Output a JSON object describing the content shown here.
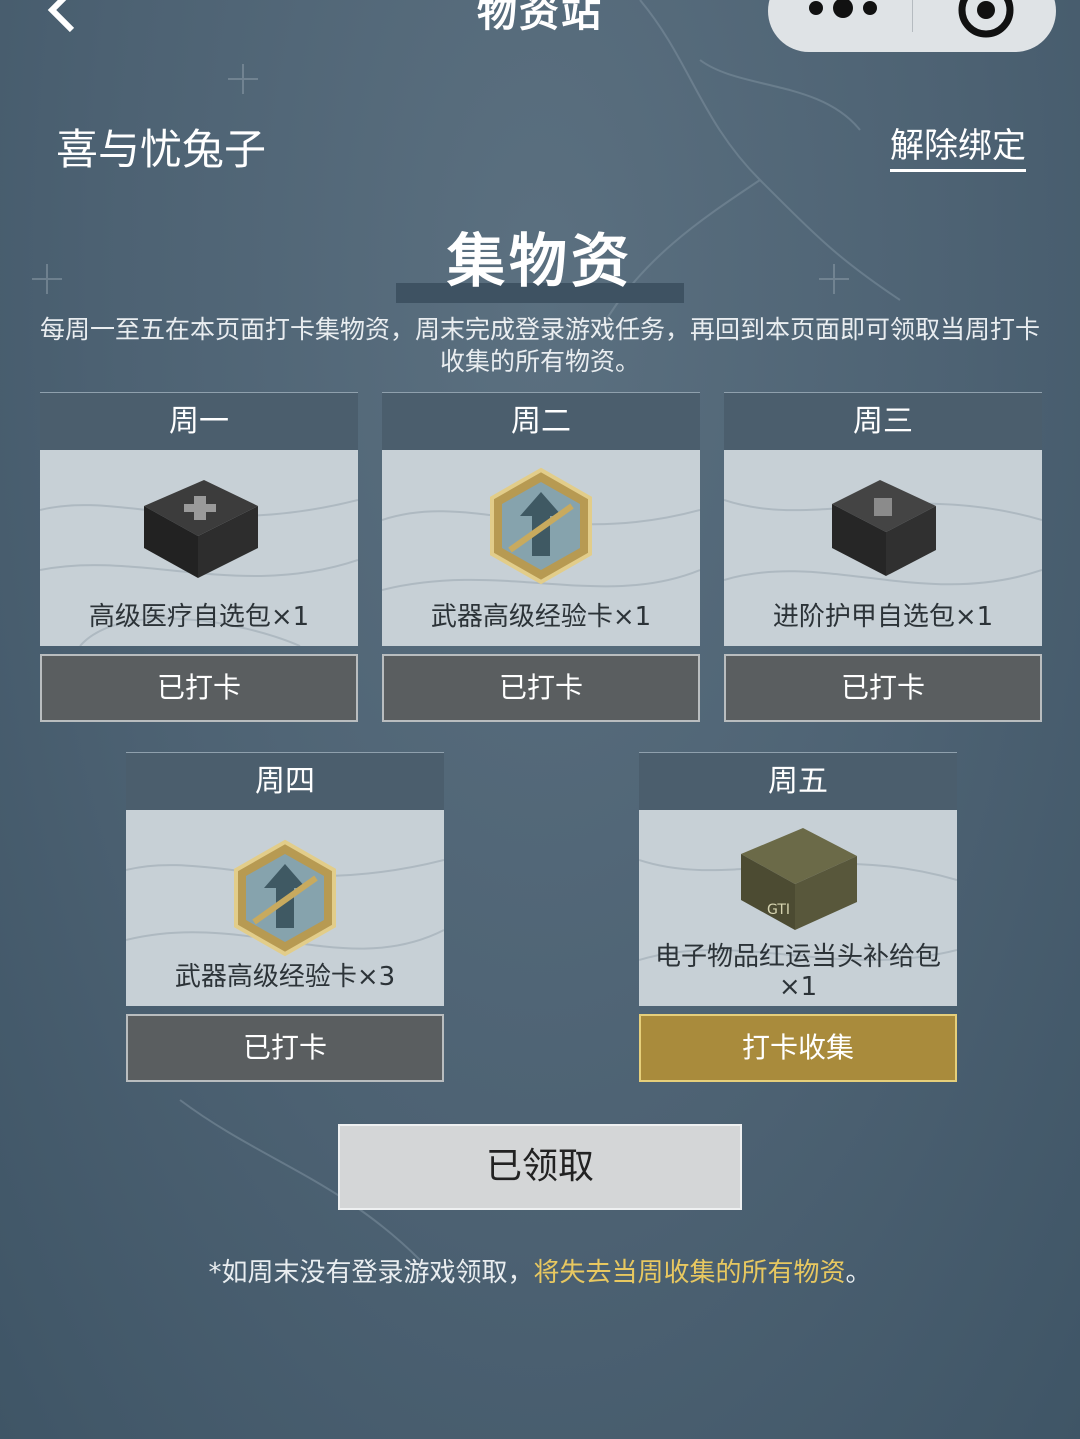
{
  "nav": {
    "title": "物资站",
    "back_icon": "chevron-left-icon",
    "more_icon": "more-dots-icon",
    "close_icon": "target-close-icon"
  },
  "user": {
    "name": "喜与忧兔子",
    "unbind_label": "解除绑定"
  },
  "section": {
    "title": "集物资",
    "description": "每周一至五在本页面打卡集物资，周末完成登录游戏任务，再回到本页面即可领取当周打卡收集的所有物资。"
  },
  "days": [
    {
      "day": "周一",
      "item": "高级医疗自选包×1",
      "icon": "medical-box-icon",
      "button": "已打卡",
      "state": "done"
    },
    {
      "day": "周二",
      "item": "武器高级经验卡×1",
      "icon": "weapon-xp-card-icon",
      "button": "已打卡",
      "state": "done"
    },
    {
      "day": "周三",
      "item": "进阶护甲自选包×1",
      "icon": "armor-box-icon",
      "button": "已打卡",
      "state": "done"
    },
    {
      "day": "周四",
      "item": "武器高级经验卡×3",
      "icon": "weapon-xp-card-icon",
      "button": "已打卡",
      "state": "done"
    },
    {
      "day": "周五",
      "item": "电子物品红运当头补给包×1",
      "icon": "supply-crate-icon",
      "button": "打卡收集",
      "state": "active"
    }
  ],
  "claim_button": "已领取",
  "footer": {
    "note_prefix": "*如周末没有登录游戏领取，",
    "note_warning": "将失去当周收集的所有物资",
    "note_suffix": "。"
  },
  "colors": {
    "gold": "#a98b3c",
    "warning_text": "#e8c860",
    "card_header": "#4b5e6d"
  }
}
